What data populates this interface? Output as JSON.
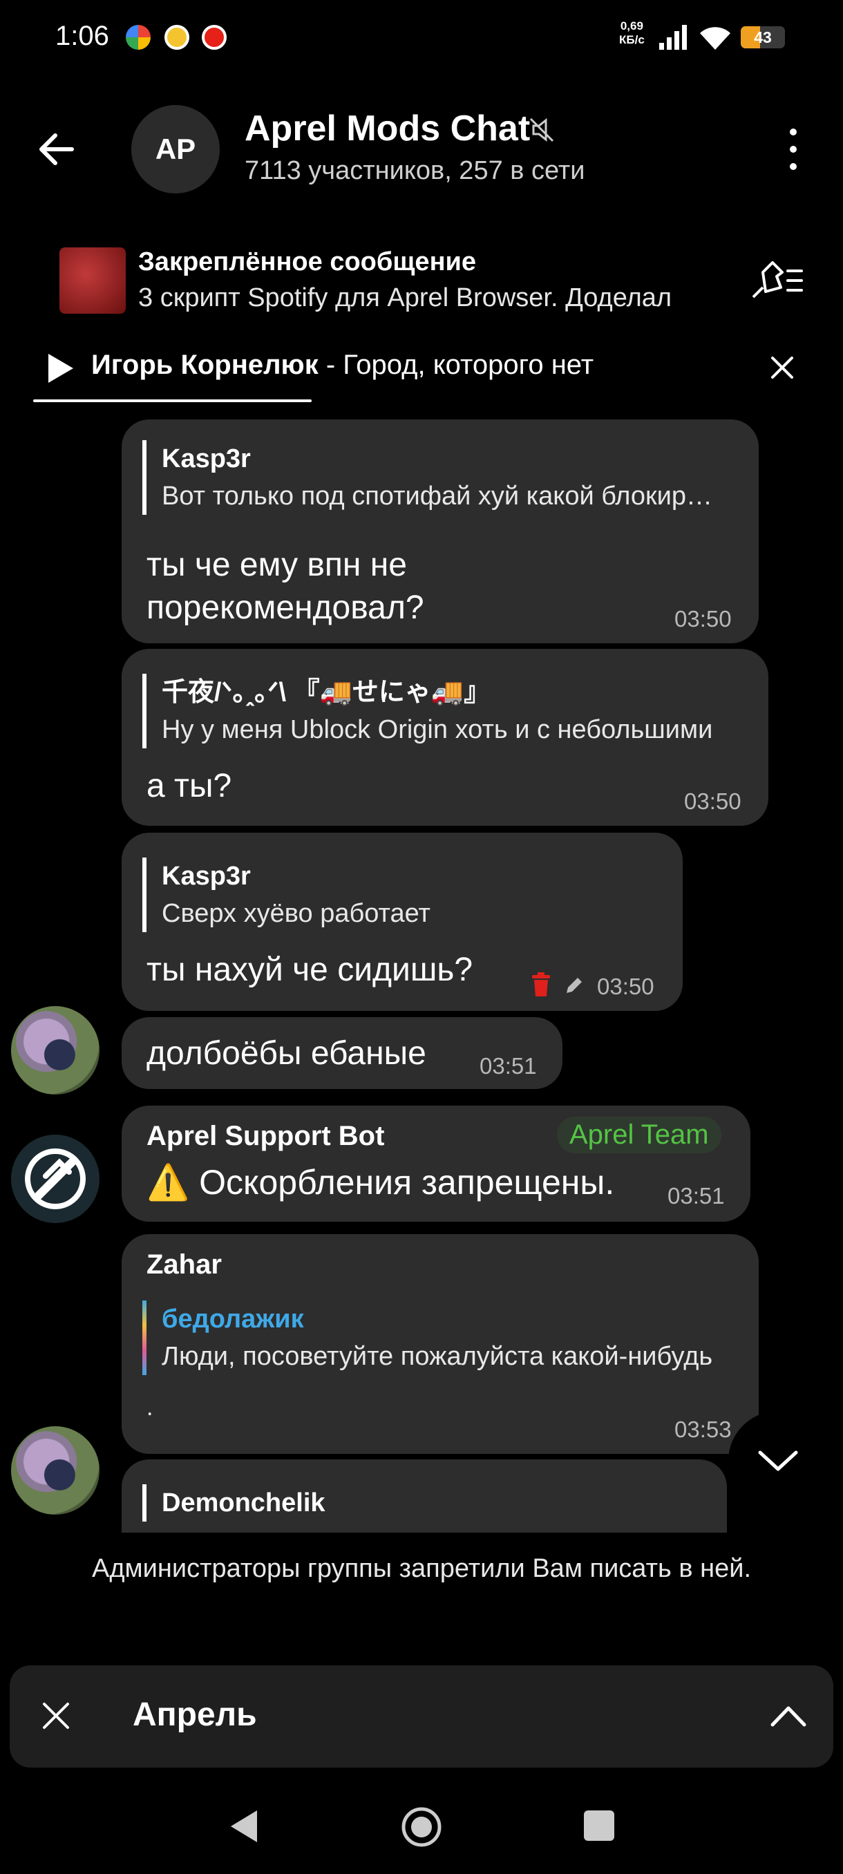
{
  "status_bar": {
    "time": "1:06",
    "net_speed_value": "0,69",
    "net_speed_unit": "КБ/с",
    "battery_level": "43",
    "notification_icons": [
      "google-icon",
      "coin-icon",
      "youtube-icon"
    ]
  },
  "header": {
    "title": "Aprel Mods Chat",
    "subtitle": "7113 участников, 257 в сети",
    "avatar_initials": "AP"
  },
  "pinned": {
    "title": "Закреплённое сообщение",
    "text": "3 скрипт Spotify для Aprel Browser. Доделал"
  },
  "audio_player": {
    "artist": "Игорь Корнелюк",
    "separator": " - ",
    "song": "Город, которого нет",
    "progress_fraction": 0.33
  },
  "messages": [
    {
      "quote_name": "Kasp3r",
      "quote_text": "Вот только под спотифай хуй какой блокировщик",
      "text_line1": "ты че ему впн не",
      "text_line2": "порекомендовал?",
      "time": "03:50"
    },
    {
      "quote_name": "千夜/ᐠ｡ꞈ｡ᐟ\\ 『🚚せにゃ🚚』",
      "quote_text": "Ну у меня Ublock Origin хоть и с небольшими",
      "text": "а ты?",
      "time": "03:50"
    },
    {
      "quote_name": "Kasp3r",
      "quote_text": "Сверх хуёво работает",
      "text": "ты нахуй че сидишь?",
      "time": "03:50"
    },
    {
      "text": "долбоёбы ебаные",
      "time": "03:51"
    },
    {
      "sender": "Aprel Support Bot",
      "badge": "Aprel Team",
      "text": "⚠️ Оскорбления запрещены.",
      "time": "03:51"
    },
    {
      "sender": "Zahar",
      "quote_name": "бедолажик",
      "quote_text": "Люди, посоветуйте пожалуйста какой-нибудь",
      "text": ".",
      "time": "03:53"
    },
    {
      "quote_name": "Demonchelik"
    }
  ],
  "blocked_notice": "Администраторы группы запретили Вам писать в ней.",
  "bottom_panel": {
    "label": "Апрель"
  },
  "colors": {
    "background": "#000000",
    "bubble": "#2d2d2d",
    "badge_green": "#54c444",
    "quote_blue": "#3fa9e8",
    "battery": "#f0a020"
  }
}
